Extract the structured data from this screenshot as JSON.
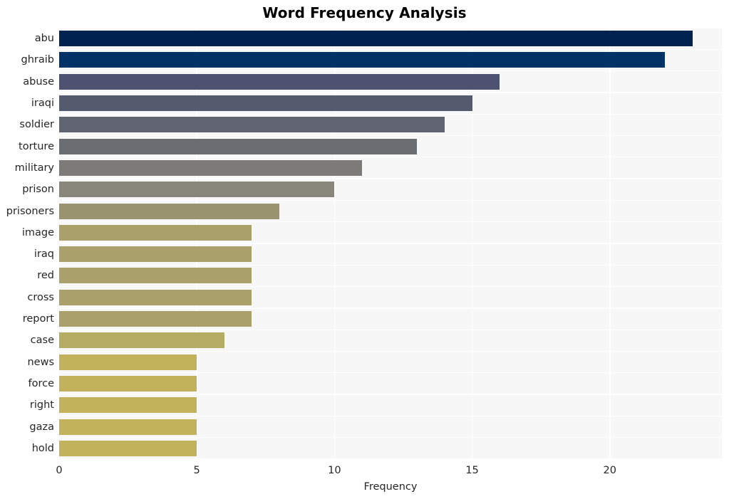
{
  "chart_data": {
    "type": "bar",
    "orientation": "horizontal",
    "title": "Word Frequency Analysis",
    "xlabel": "Frequency",
    "ylabel": "",
    "categories": [
      "abu",
      "ghraib",
      "abuse",
      "iraqi",
      "soldier",
      "torture",
      "military",
      "prison",
      "prisoners",
      "image",
      "iraq",
      "red",
      "cross",
      "report",
      "case",
      "news",
      "force",
      "right",
      "gaza",
      "hold"
    ],
    "values": [
      23,
      22,
      16,
      15,
      14,
      13,
      11,
      10,
      8,
      7,
      7,
      7,
      7,
      7,
      6,
      5,
      5,
      5,
      5,
      5
    ],
    "bar_colors": [
      "#00224e",
      "#003167",
      "#4c5270",
      "#555b6e",
      "#5f6470",
      "#6a6d71",
      "#7c7b77",
      "#88857a",
      "#9a9370",
      "#a9a169",
      "#a9a169",
      "#a9a169",
      "#a9a169",
      "#a9a169",
      "#b5ac64",
      "#c3b25c",
      "#c3b25c",
      "#c3b25c",
      "#c3b25c",
      "#c3b25c"
    ],
    "xlim": [
      0,
      24.07
    ],
    "xticks": [
      0,
      5,
      10,
      15,
      20
    ],
    "xtick_labels": [
      "0",
      "5",
      "10",
      "15",
      "20"
    ],
    "grid": true,
    "grid_color": "#ffffff",
    "plot_background": "#f7f7f8",
    "figure_background": "#ffffff",
    "legend": null
  }
}
